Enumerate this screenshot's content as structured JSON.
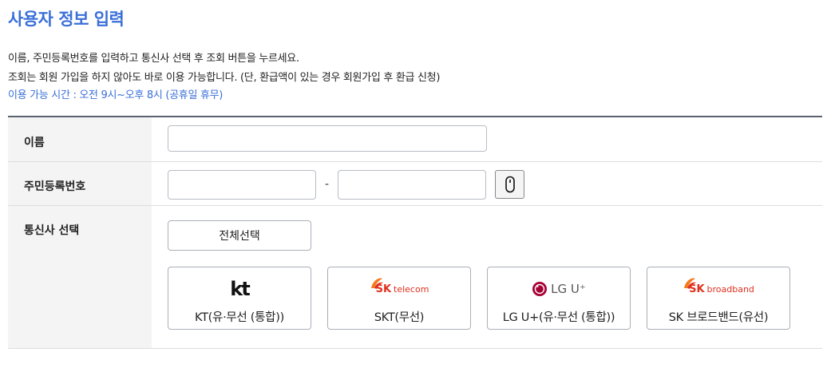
{
  "title": "사용자 정보 입력",
  "description": {
    "line1": "이름, 주민등록번호를 입력하고 통신사 선택 후 조회 버튼을 누르세요.",
    "line2": "조회는 회원 가입을 하지 않아도 바로 이용 가능합니다. (단, 환급액이 있는 경우 회원가입 후 환급 신청)",
    "hours": "이용 가능 시간 : 오전 9시~오후 8시 (공휴일 휴무)"
  },
  "form": {
    "name_label": "이름",
    "name_value": "",
    "rrn_label": "주민등록번호",
    "rrn_front_value": "",
    "rrn_back_value": "",
    "rrn_separator": "-",
    "carrier_label": "통신사 선택",
    "select_all_label": "전체선택"
  },
  "carriers": [
    {
      "name": "KT(유·무선 (통합))",
      "logo_text": "kt",
      "icon": "kt-logo-icon"
    },
    {
      "name": "SKT(무선)",
      "logo_brand": "SK",
      "logo_text": "telecom",
      "icon": "skt-logo-icon"
    },
    {
      "name": "LG U+(유·무선 (통합))",
      "logo_text": "LG U⁺",
      "icon": "lg-uplus-logo-icon"
    },
    {
      "name": "SK 브로드밴드(유선)",
      "logo_brand": "SK",
      "logo_text": "broadband",
      "icon": "sk-broadband-logo-icon"
    }
  ],
  "colors": {
    "title": "#3a6fd8",
    "sk_red": "#e0301e",
    "sk_orange": "#f47a20",
    "lg_red": "#a50034"
  }
}
